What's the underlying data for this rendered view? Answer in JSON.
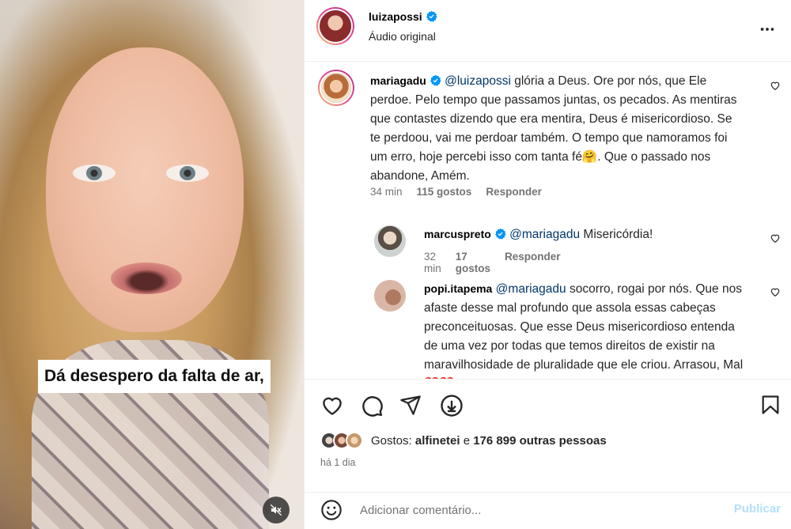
{
  "video": {
    "caption": "Dá desespero da falta de ar,",
    "mute_icon": "speaker-muted-icon"
  },
  "header": {
    "username": "luizapossi",
    "subtitle": "Áudio original",
    "more_icon": "more-horizontal-icon"
  },
  "comments": [
    {
      "username": "mariagadu",
      "mention": "@luizapossi",
      "text": " glória a Deus. Ore por nós, que Ele perdoe. Pelo tempo que passamos juntas, os pecados. As mentiras que contastes dizendo que era mentira, Deus é misericordioso. Se te perdoou, vai me perdoar também. O tempo que namoramos foi um erro, hoje percebi isso com tanta fé🤗. Que o passado nos abandone, Amém.",
      "time": "34 min",
      "likes": "115 gostos",
      "reply": "Responder"
    },
    {
      "username": "marcuspreto",
      "mention": "@mariagadu",
      "text": " Misericórdia!",
      "time": "32 min",
      "likes": "17 gostos",
      "reply": "Responder"
    },
    {
      "username": "popi.itapema",
      "mention": "@mariagadu",
      "text": " socorro, rogai por nós. Que nos afaste desse mal profundo que assola essas cabeças preconceituosas. Que esse Deus misericordioso entenda de uma vez por todas que temos direitos de existir na maravilhosidade de pluralidade que ele criou. Arrasou, Mal ❤️❤️"
    }
  ],
  "actions": {
    "icons": [
      "heart-icon",
      "comment-icon",
      "share-icon",
      "download-icon",
      "bookmark-icon"
    ]
  },
  "likes": {
    "prefix": "Gostos: ",
    "first_user": "alfinetei",
    "connector": " e ",
    "others": "176 899 outras pessoas"
  },
  "time_ago": "há 1 dia",
  "add_comment": {
    "placeholder": "Adicionar comentário...",
    "publish": "Publicar"
  },
  "colors": {
    "verified": "#0095f6",
    "mention": "#00376b",
    "publish_disabled": "#b2dffc",
    "heart_red": "#e0245e"
  }
}
